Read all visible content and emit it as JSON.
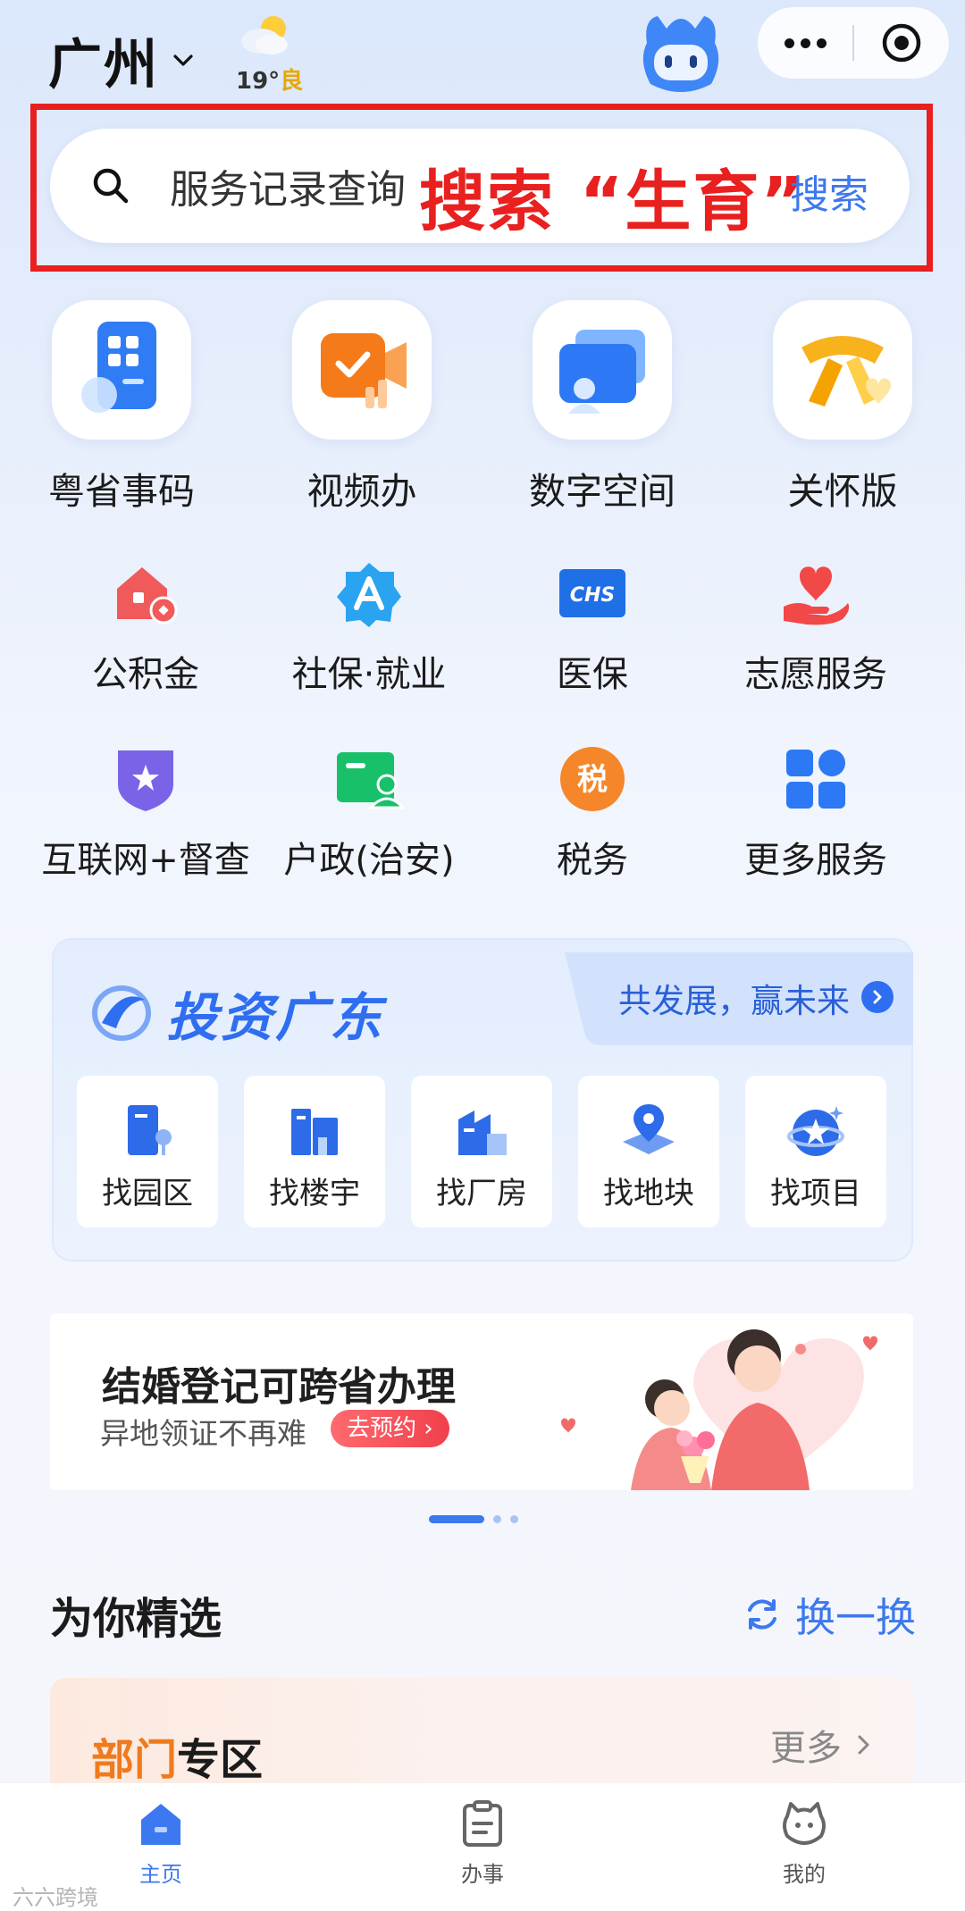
{
  "header": {
    "city": "广州",
    "weather": {
      "temp": "19°",
      "aqi": "良"
    }
  },
  "search": {
    "placeholder": "服务记录查询",
    "annotation": "搜索 “生育”",
    "button": "搜索"
  },
  "main_services": [
    {
      "label": "粤省事码",
      "icon": "qr-code-icon"
    },
    {
      "label": "视频办",
      "icon": "video-camera-icon"
    },
    {
      "label": "数字空间",
      "icon": "digital-wallet-icon"
    },
    {
      "label": "关怀版",
      "icon": "scarf-heart-icon"
    }
  ],
  "services": [
    {
      "label": "公积金",
      "icon": "housing-fund-icon"
    },
    {
      "label": "社保·就业",
      "icon": "social-security-icon"
    },
    {
      "label": "医保",
      "icon": "chs-medical-insurance-icon"
    },
    {
      "label": "志愿服务",
      "icon": "hand-heart-icon"
    },
    {
      "label": "互联网+督查",
      "icon": "shield-star-icon"
    },
    {
      "label": "户政(治安)",
      "icon": "household-id-icon"
    },
    {
      "label": "税务",
      "icon": "tax-icon"
    },
    {
      "label": "更多服务",
      "icon": "grid-more-icon"
    }
  ],
  "invest": {
    "title": "投资广东",
    "tagline": "共发展，赢未来",
    "items": [
      {
        "label": "找园区",
        "icon": "park-building-icon"
      },
      {
        "label": "找楼宇",
        "icon": "office-building-icon"
      },
      {
        "label": "找厂房",
        "icon": "factory-icon"
      },
      {
        "label": "找地块",
        "icon": "land-pin-icon"
      },
      {
        "label": "找项目",
        "icon": "project-star-icon"
      }
    ]
  },
  "banner": {
    "title": "结婚登记可跨省办理",
    "subtitle": "异地领证不再难",
    "button": "去预约",
    "pages": 3,
    "active_page": 1
  },
  "recommend": {
    "title": "为你精选",
    "refresh": "换一换",
    "dept_title_a": "部门",
    "dept_title_b": "专区",
    "more": "更多"
  },
  "tabbar": [
    {
      "label": "主页",
      "icon": "home-icon",
      "active": true
    },
    {
      "label": "办事",
      "icon": "clipboard-icon",
      "active": false
    },
    {
      "label": "我的",
      "icon": "profile-face-icon",
      "active": false
    }
  ],
  "watermark": "六六跨境",
  "colors": {
    "accent": "#3c78f0",
    "annotation_red": "#e8201f",
    "orange": "#f07a1c"
  }
}
